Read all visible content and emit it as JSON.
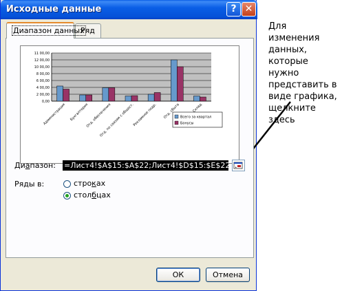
{
  "window": {
    "title": "Исходные данные",
    "help_label": "?",
    "close_label": "✕"
  },
  "tabs": [
    {
      "label": "Диапазон данных",
      "active": true
    },
    {
      "label": "Ряд",
      "active": false
    }
  ],
  "chart_data": {
    "type": "bar",
    "categories": [
      "Администрация",
      "Бухгалтерия",
      "Отд. обеспечения",
      "Отд. по связям с общест.",
      "Рекламное подр.",
      "Отд. сбыта",
      "Склад"
    ],
    "series": [
      {
        "name": "Всего за квартал",
        "values": [
          4400,
          1800,
          3900,
          1500,
          2000,
          12000,
          1500
        ]
      },
      {
        "name": "Бонусы",
        "values": [
          3500,
          1800,
          3900,
          1600,
          2500,
          10000,
          1200
        ]
      }
    ],
    "y_ticks": [
      "11 00,00",
      "12 00,00",
      "10 00,00",
      "8 00,00",
      "6 00,00",
      "4 00,00",
      "2 00,00",
      "0,00"
    ],
    "ylim": [
      0,
      14000
    ],
    "grid": true,
    "legend": "right",
    "colors": {
      "series1": "#6699cc",
      "series2": "#993366",
      "plot_bg": "#c0c0c0"
    }
  },
  "form": {
    "range_label_prefix": "Ди",
    "range_label_underlined": "а",
    "range_label_suffix": "пазон:",
    "range_value": "=Лист4!$A$15:$A$22;Лист4!$D$15:$E$22",
    "series_in_label": "Ряды в:",
    "rows_prefix": "стро",
    "rows_underlined": "к",
    "rows_suffix": "ах",
    "columns_prefix": "стол",
    "columns_underlined": "б",
    "columns_suffix": "цах",
    "selected": "columns"
  },
  "buttons": {
    "ok": "ОК",
    "cancel": "Отмена"
  },
  "annotation": {
    "text": "Для изменения данных, которые нужно представить в виде графика, щелкните здесь"
  }
}
